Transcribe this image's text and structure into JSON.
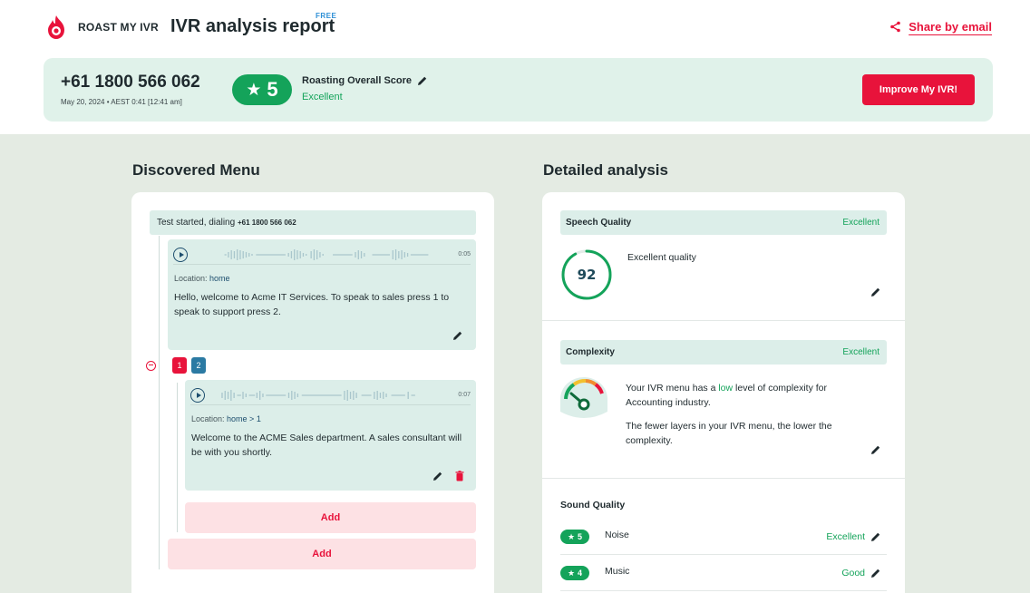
{
  "header": {
    "brand_name": "ROAST MY IVR",
    "report_title": "IVR analysis report",
    "free_badge": "FREE",
    "share_label": "Share by email"
  },
  "summary": {
    "phone": "+61 1800 566 062",
    "date": "May 20, 2024 • AEST 0:41 [12:41 am]",
    "score": "5",
    "score_label": "Roasting Overall Score",
    "score_verdict": "Excellent",
    "improve_label": "Improve My IVR!"
  },
  "discovered_menu": {
    "title": "Discovered Menu",
    "dial_prefix": "Test started, dialing",
    "dial_number": "+61 1800 566 062",
    "messages": [
      {
        "duration": "0:05",
        "location_prefix": "Location:",
        "location": "home",
        "text": "Hello, welcome to Acme IT Services. To speak to sales press 1 to speak to support press 2."
      },
      {
        "duration": "0:07",
        "location_prefix": "Location:",
        "location": "home > 1",
        "text": "Welcome to the ACME Sales department. A sales consultant will be with you shortly."
      }
    ],
    "keys": [
      "1",
      "2"
    ],
    "add_label": "Add"
  },
  "detailed_analysis": {
    "title": "Detailed analysis",
    "speech_quality": {
      "title": "Speech Quality",
      "verdict": "Excellent",
      "score": "92",
      "score_fraction": 0.92,
      "text": "Excellent quality"
    },
    "complexity": {
      "title": "Complexity",
      "verdict": "Excellent",
      "text_prefix": "Your IVR menu has a",
      "level": "low",
      "text_suffix": "level of complexity for Accounting industry.",
      "note": "The fewer layers in your IVR menu, the lower the complexity."
    },
    "sound_quality": {
      "title": "Sound Quality",
      "rows": [
        {
          "score": "5",
          "name": "Noise",
          "verdict": "Excellent"
        },
        {
          "score": "4",
          "name": "Music",
          "verdict": "Good"
        }
      ]
    }
  },
  "colors": {
    "accent_red": "#e8133b",
    "success_green": "#14a35a",
    "panel_mint": "#dceee9",
    "background_sage": "#e4ebe3"
  }
}
